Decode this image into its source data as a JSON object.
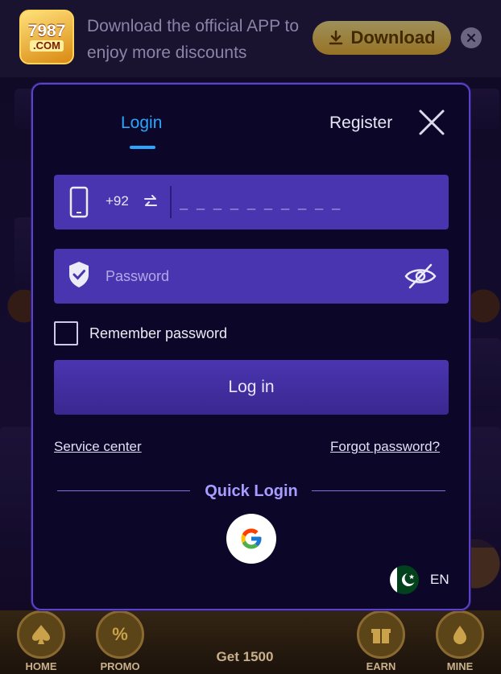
{
  "banner": {
    "logo_number": "7987",
    "logo_domain": ".COM",
    "text": "Download the official APP to enjoy more discounts",
    "download_label": "Download"
  },
  "modal": {
    "tabs": [
      {
        "label": "Login",
        "active": true
      },
      {
        "label": "Register",
        "active": false
      }
    ],
    "phone": {
      "country_code": "+92",
      "placeholder": "_ _ _ _ _ _ _ _ _ _",
      "value": ""
    },
    "password": {
      "placeholder": "Password",
      "value": ""
    },
    "remember_label": "Remember password",
    "remember_checked": false,
    "login_label": "Log in",
    "service_center_label": "Service center",
    "forgot_password_label": "Forgot password?",
    "quick_login_label": "Quick Login",
    "language_label": "EN"
  },
  "bottom_nav": {
    "items": [
      {
        "label": "HOME",
        "icon": "spade-icon"
      },
      {
        "label": "PROMO",
        "icon": "percent-tag-icon"
      },
      {
        "label": "EARN",
        "icon": "gift-icon"
      },
      {
        "label": "MINE",
        "icon": "user-drop-icon"
      }
    ],
    "center_label": "Get 1500"
  },
  "colors": {
    "accent_tab": "#2aa6ff",
    "field_bg": "#4a35b0",
    "modal_bg": "#0c0628",
    "modal_border": "#5b42c9",
    "quick_login": "#a79cff"
  }
}
